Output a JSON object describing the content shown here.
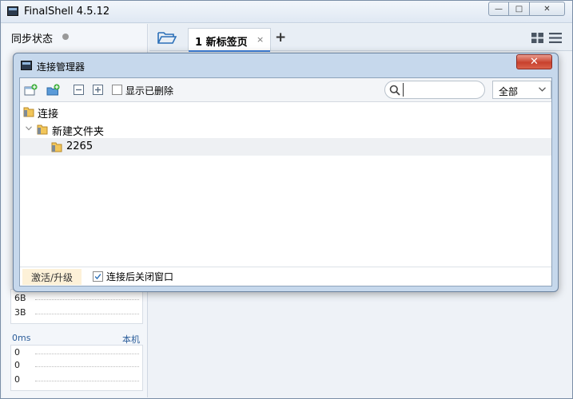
{
  "main_window": {
    "title": "FinalShell 4.5.12",
    "caption_minimize": "—",
    "caption_maximize": "□",
    "caption_close": "✕"
  },
  "left_panel": {
    "sync_label": "同步状态",
    "traffic_rows": [
      "6B",
      "3B"
    ],
    "ping_label": "0ms",
    "local_label": "本机",
    "ping_rows": [
      "0",
      "0",
      "0"
    ]
  },
  "tab_bar": {
    "tabs": [
      {
        "label": "1 新标签页",
        "close": "×"
      }
    ],
    "add_tab": "+"
  },
  "dialog": {
    "title": "连接管理器",
    "close": "✕",
    "toolbar": {
      "show_deleted_label": "显示已删除",
      "search_value": "",
      "filter_value": "全部"
    },
    "tree": [
      {
        "label": "连接",
        "level": 0
      },
      {
        "label": "新建文件夹",
        "level": 1,
        "expanded": true
      },
      {
        "label": "2265",
        "level": 2,
        "selected": true
      }
    ],
    "footer": {
      "activate_label": "激活/升级",
      "close_after_label": "连接后关闭窗口",
      "close_after_checked": true
    }
  },
  "colors": {
    "accent": "#3b7dd8",
    "close_red": "#c8412d",
    "folder_yellow": "#f2c65a"
  }
}
